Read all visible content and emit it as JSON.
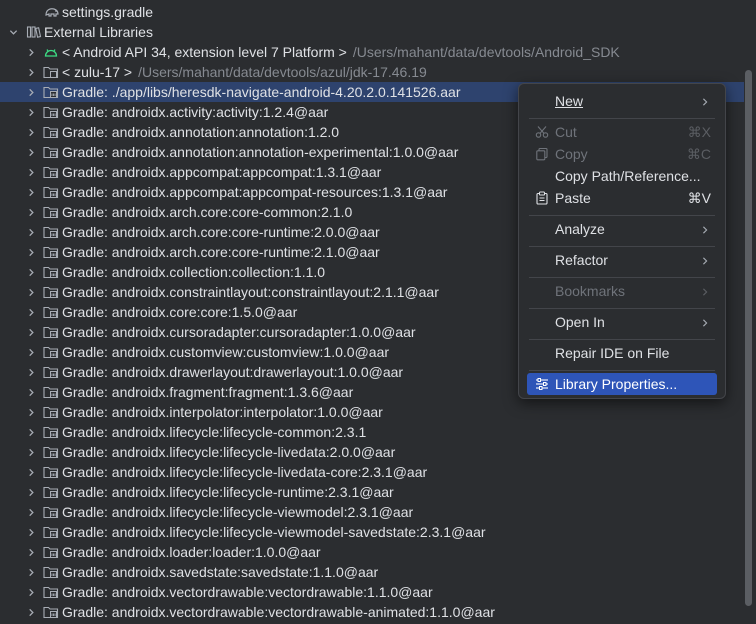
{
  "tree": {
    "top_item": "settings.gradle",
    "external_libraries": "External Libraries",
    "android_api": {
      "label": "< Android API 34, extension level 7 Platform >",
      "path": "/Users/mahant/data/devtools/Android_SDK"
    },
    "jdk": {
      "label": "< zulu-17 >",
      "path": "/Users/mahant/data/devtools/azul/jdk-17.46.19"
    },
    "libraries": [
      "Gradle: ./app/libs/heresdk-navigate-android-4.20.2.0.141526.aar",
      "Gradle: androidx.activity:activity:1.2.4@aar",
      "Gradle: androidx.annotation:annotation:1.2.0",
      "Gradle: androidx.annotation:annotation-experimental:1.0.0@aar",
      "Gradle: androidx.appcompat:appcompat:1.3.1@aar",
      "Gradle: androidx.appcompat:appcompat-resources:1.3.1@aar",
      "Gradle: androidx.arch.core:core-common:2.1.0",
      "Gradle: androidx.arch.core:core-runtime:2.0.0@aar",
      "Gradle: androidx.arch.core:core-runtime:2.1.0@aar",
      "Gradle: androidx.collection:collection:1.1.0",
      "Gradle: androidx.constraintlayout:constraintlayout:2.1.1@aar",
      "Gradle: androidx.core:core:1.5.0@aar",
      "Gradle: androidx.cursoradapter:cursoradapter:1.0.0@aar",
      "Gradle: androidx.customview:customview:1.0.0@aar",
      "Gradle: androidx.drawerlayout:drawerlayout:1.0.0@aar",
      "Gradle: androidx.fragment:fragment:1.3.6@aar",
      "Gradle: androidx.interpolator:interpolator:1.0.0@aar",
      "Gradle: androidx.lifecycle:lifecycle-common:2.3.1",
      "Gradle: androidx.lifecycle:lifecycle-livedata:2.0.0@aar",
      "Gradle: androidx.lifecycle:lifecycle-livedata-core:2.3.1@aar",
      "Gradle: androidx.lifecycle:lifecycle-runtime:2.3.1@aar",
      "Gradle: androidx.lifecycle:lifecycle-viewmodel:2.3.1@aar",
      "Gradle: androidx.lifecycle:lifecycle-viewmodel-savedstate:2.3.1@aar",
      "Gradle: androidx.loader:loader:1.0.0@aar",
      "Gradle: androidx.savedstate:savedstate:1.1.0@aar",
      "Gradle: androidx.vectordrawable:vectordrawable:1.1.0@aar",
      "Gradle: androidx.vectordrawable:vectordrawable-animated:1.1.0@aar"
    ]
  },
  "menu": {
    "new": "New",
    "cut": "Cut",
    "cut_shortcut": "⌘X",
    "copy": "Copy",
    "copy_shortcut": "⌘C",
    "copy_path": "Copy Path/Reference...",
    "paste": "Paste",
    "paste_shortcut": "⌘V",
    "analyze": "Analyze",
    "refactor": "Refactor",
    "bookmarks": "Bookmarks",
    "open_in": "Open In",
    "repair_ide": "Repair IDE on File",
    "library_properties": "Library Properties..."
  },
  "colors": {
    "background": "#2b2d30",
    "selection": "#2e436e",
    "menu_highlight": "#2e55b8",
    "android_green": "#3ddc84"
  }
}
